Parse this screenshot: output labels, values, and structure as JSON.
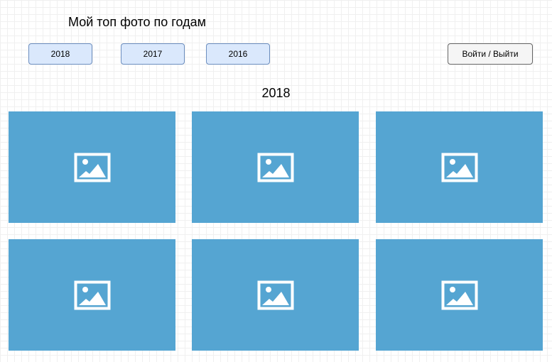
{
  "header": {
    "title": "Мой топ фото по годам"
  },
  "year_tabs": [
    {
      "label": "2018"
    },
    {
      "label": "2017"
    },
    {
      "label": "2016"
    }
  ],
  "auth": {
    "label": "Войти / Выйти"
  },
  "gallery": {
    "title": "2018",
    "photos": [
      {
        "icon": "image-placeholder-icon"
      },
      {
        "icon": "image-placeholder-icon"
      },
      {
        "icon": "image-placeholder-icon"
      },
      {
        "icon": "image-placeholder-icon"
      },
      {
        "icon": "image-placeholder-icon"
      },
      {
        "icon": "image-placeholder-icon"
      }
    ],
    "tile_color": "#55a5d2"
  },
  "colors": {
    "tab_fill": "#dae8fc",
    "tab_border": "#6c8ebf",
    "auth_fill": "#f5f5f5",
    "auth_border": "#666666"
  }
}
